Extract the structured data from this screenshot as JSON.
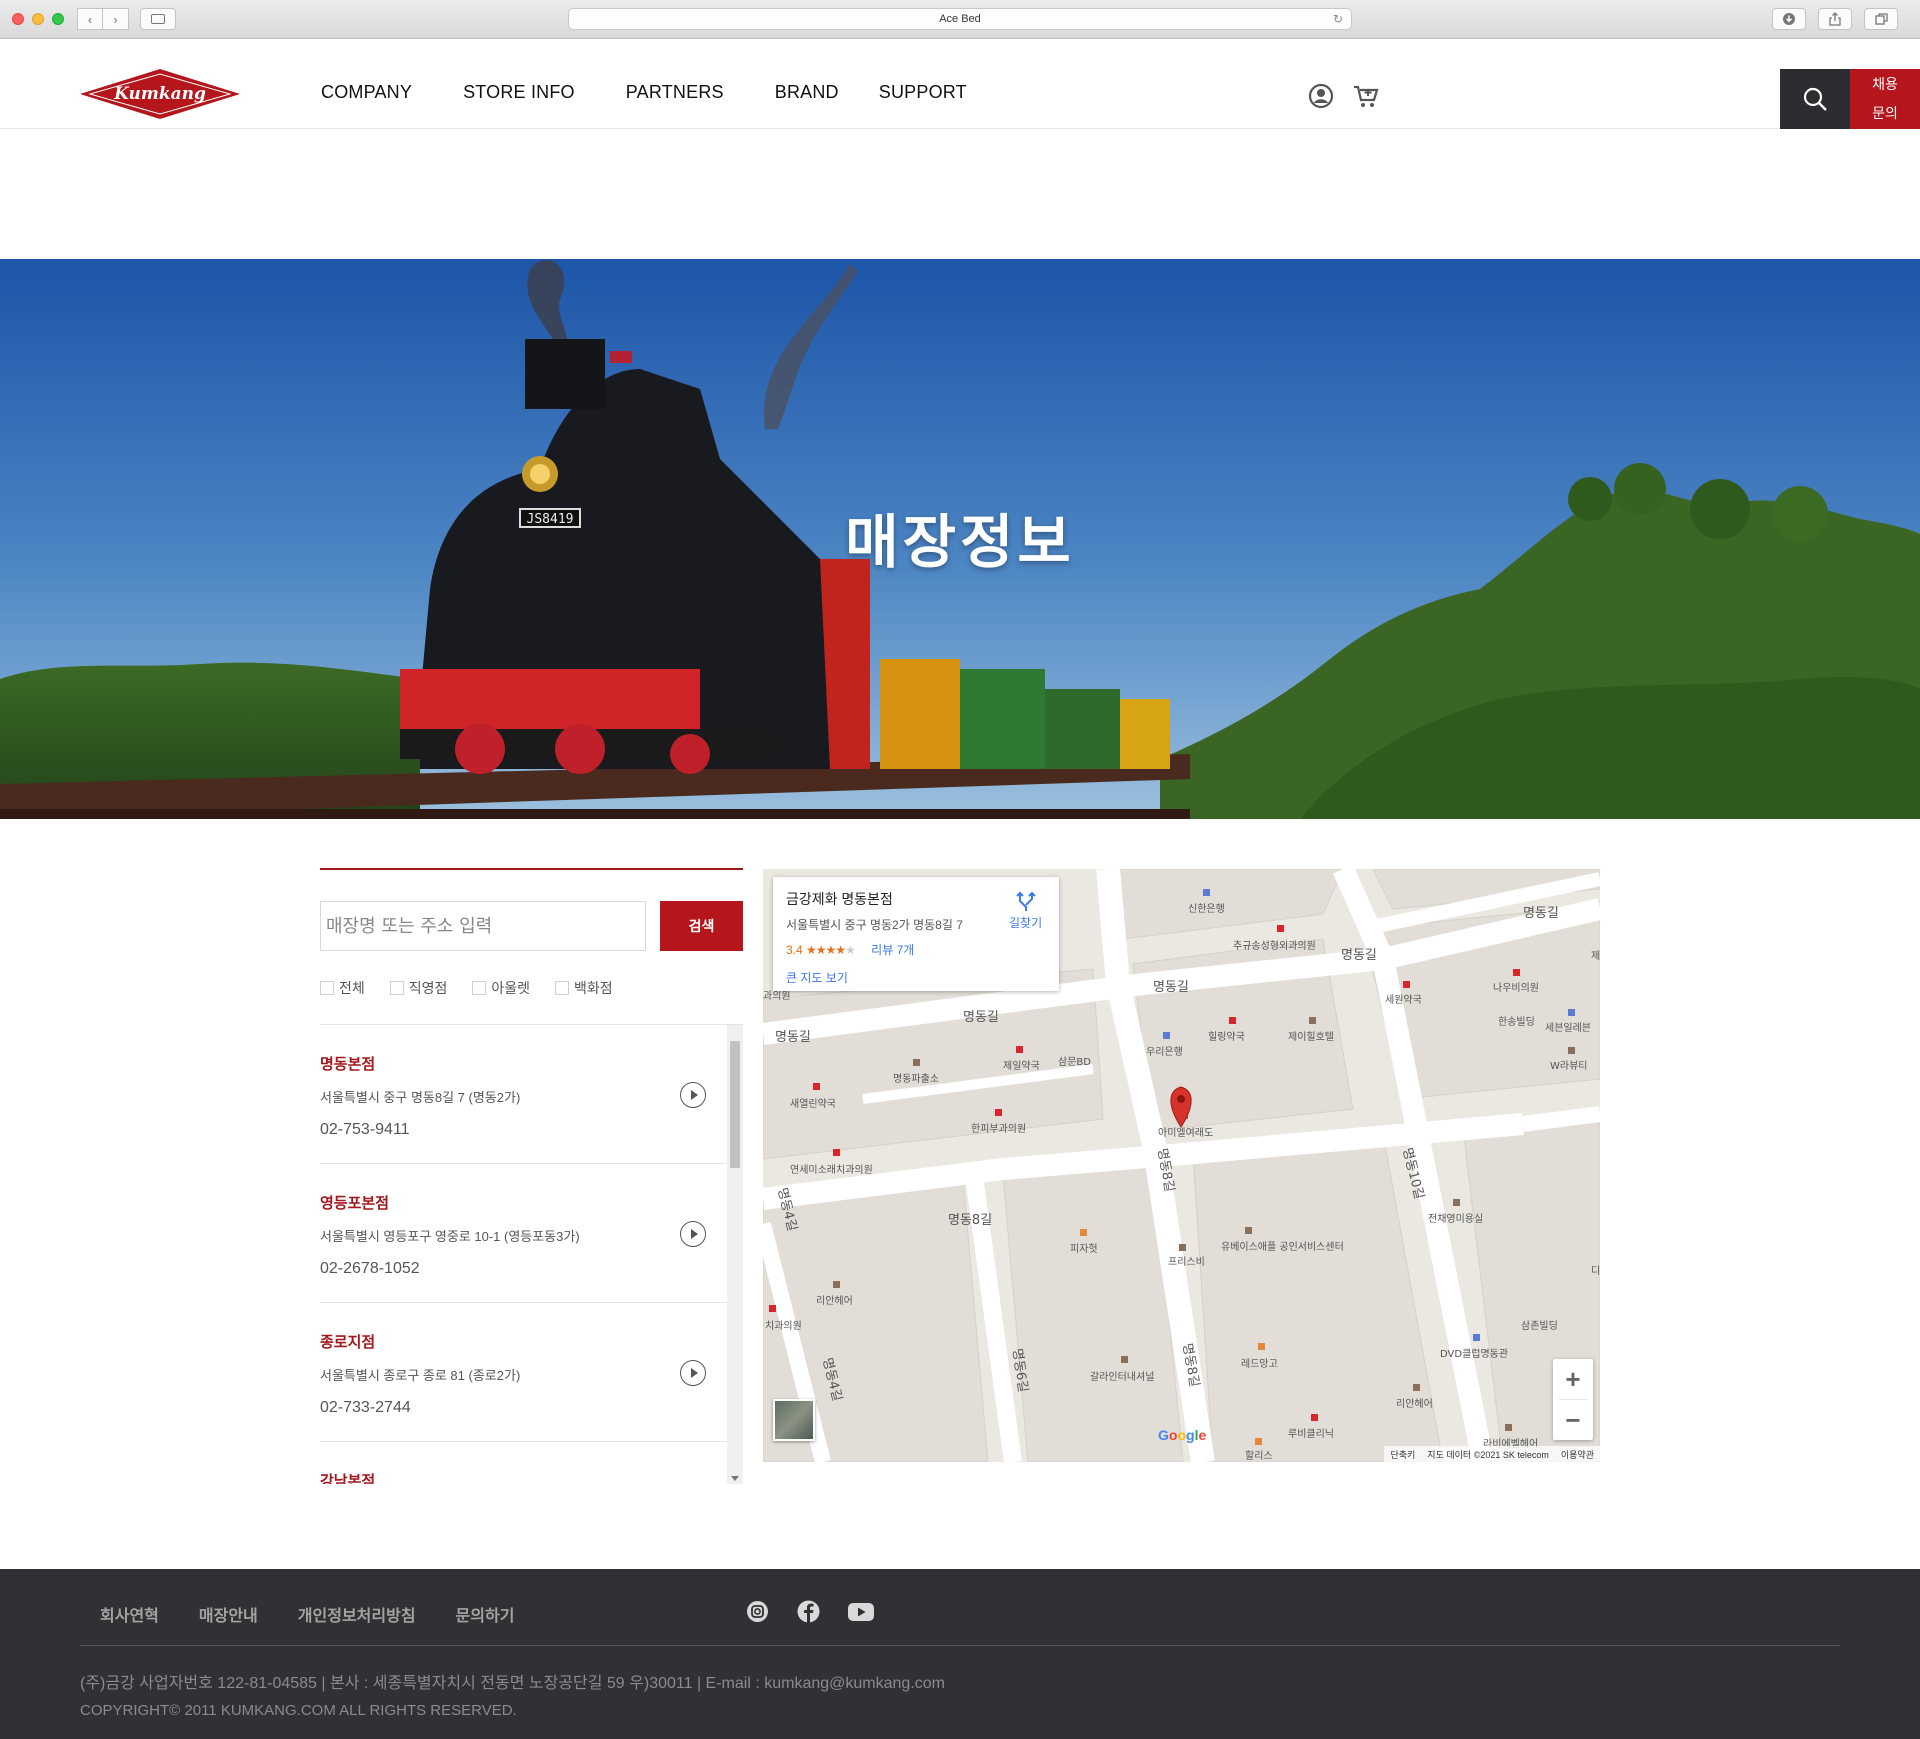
{
  "browser": {
    "title": "Ace Bed"
  },
  "header": {
    "logo_text": "Kumkang",
    "nav": [
      "COMPANY",
      "STORE INFO",
      "PARTNERS",
      "BRAND",
      "SUPPORT"
    ],
    "recruit_line1": "채용",
    "recruit_line2": "문의"
  },
  "hero": {
    "title": "매장정보",
    "locomotive_number": "JS8419"
  },
  "store_search": {
    "placeholder": "매장명 또는 주소 입력",
    "button_label": "검색",
    "filters": [
      "전체",
      "직영점",
      "아울렛",
      "백화점"
    ]
  },
  "stores": [
    {
      "name": "명동본점",
      "address": "서울특별시 중구 명동8길 7 (명동2가)",
      "phone": "02-753-9411"
    },
    {
      "name": "영등포본점",
      "address": "서울특별시 영등포구 영중로 10-1 (영등포동3가)",
      "phone": "02-2678-1052"
    },
    {
      "name": "종로지점",
      "address": "서울특별시 종로구 종로 81 (종로2가)",
      "phone": "02-733-2744"
    },
    {
      "name": "강남본점",
      "address": "",
      "phone": ""
    }
  ],
  "map": {
    "card": {
      "title": "금강제화 명동본점",
      "address": "서울특별시 중구 명동2가 명동8길 7",
      "rating": "3.4",
      "stars_full": "★★★★",
      "stars_empty": "★",
      "reviews": "리뷰 7개",
      "large_map_link": "큰 지도 보기",
      "directions": "길찾기"
    },
    "streets": [
      "명동길",
      "명동길",
      "명동길",
      "명동길",
      "명동길",
      "명동8길",
      "명동8길",
      "명동8길",
      "명동4길",
      "명동4길",
      "명동6길",
      "명동10길"
    ],
    "places": [
      "신한은행",
      "추규송성형외과의원",
      "나우비의원",
      "세원약국",
      "한송빌딩",
      "세븐일레븐",
      "W라뷰티",
      "우리은행",
      "힐링약국",
      "제이힐호텔",
      "명동파출소",
      "제일약국",
      "삼문BD",
      "새열린약국",
      "한피부과의원",
      "아미엘여래도",
      "연세미소래치과의원",
      "전채영미용실",
      "피자헛",
      "프리스비",
      "유베이스애플 공인서비스센터",
      "리안헤어",
      "치과의원",
      "갈라인터내셔널",
      "레드망고",
      "DVD클럽명동관",
      "삼존빌딩",
      "리안헤어",
      "루비클리닉",
      "할리스",
      "라비에벨헤어",
      "과의원",
      "제",
      "디"
    ],
    "google": "Google",
    "attribution": [
      "단축키",
      "지도 데이터 ©2021 SK telecom",
      "이용약관"
    ],
    "zoom_in": "+",
    "zoom_out": "−"
  },
  "footer": {
    "links": [
      "회사연혁",
      "매장안내",
      "개인정보처리방침",
      "문의하기"
    ],
    "info": "(주)금강 사업자번호 122-81-04585 | 본사 : 세종특별자치시 전동면 노장공단길 59 우)30011 | E-mail : kumkang@kumkang.com",
    "copyright": "COPYRIGHT© 2011 KUMKANG.COM ALL RIGHTS RESERVED."
  },
  "colors": {
    "brand_red": "#b4161b",
    "dark": "#2b2d30",
    "footer_bg": "#303134"
  }
}
